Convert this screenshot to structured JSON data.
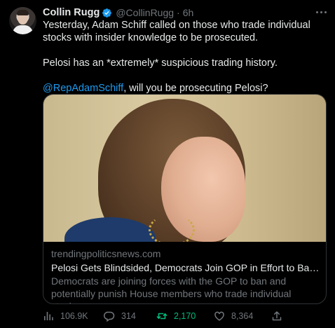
{
  "author": {
    "name": "Collin Rugg",
    "handle": "@CollinRugg",
    "separator": "·",
    "time": "6h"
  },
  "tweet": {
    "line1": "Yesterday, Adam Schiff called on those who trade individual stocks with insider knowledge to be prosecuted.",
    "line2": "Pelosi has an *extremely* suspicious trading history.",
    "mention": "@RepAdamSchiff",
    "line3_rest": ", will you be prosecuting Pelosi?"
  },
  "card": {
    "domain": "trendingpoliticsnews.com",
    "title": "Pelosi Gets Blindsided, Democrats Join GOP in Effort to Ban and Punish...",
    "description": "Democrats are joining forces with the GOP to ban and potentially punish House members who trade individual stocks."
  },
  "actions": {
    "views": "106.9K",
    "replies": "314",
    "retweets": "2,170",
    "likes": "8,364"
  },
  "colors": {
    "background": "#000000",
    "text": "#e7e9ea",
    "muted": "#71767b",
    "link": "#1d9bf0",
    "retweet_active": "#00ba7c",
    "verified": "#1d9bf0"
  }
}
